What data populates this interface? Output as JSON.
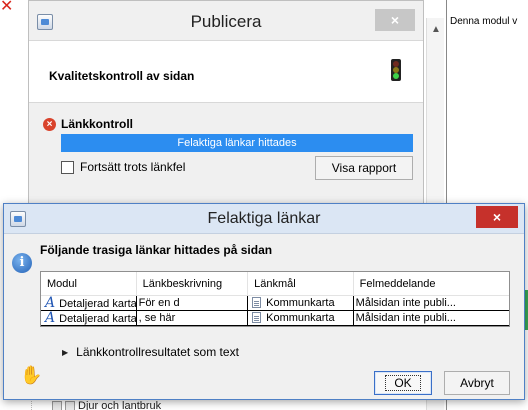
{
  "background": {
    "right_pane_text": "Denna modul v",
    "tree_item_label": "Djur och lantbruk"
  },
  "publish_dialog": {
    "title": "Publicera",
    "close_label": "×",
    "header_title": "Kvalitetskontroll av sidan",
    "section_title": "Länkkontroll",
    "progress_text": "Felaktiga länkar hittades",
    "checkbox_label": "Fortsätt trots länkfel",
    "report_button": "Visa rapport"
  },
  "links_dialog": {
    "title": "Felaktiga länkar",
    "close_label": "×",
    "header": "Följande trasiga länkar hittades på sidan",
    "columns": [
      "Modul",
      "Länkbeskrivning",
      "Länkmål",
      "Felmeddelande"
    ],
    "rows": [
      {
        "modul": "Detaljerad karta",
        "beskrivning": "För en d",
        "mal": "Kommunkarta",
        "fel": "Målsidan inte publi..."
      },
      {
        "modul": "Detaljerad karta",
        "beskrivning": ", se här",
        "mal": "Kommunkarta",
        "fel": "Målsidan inte publi..."
      }
    ],
    "expander_label": "Länkkontrollresultatet som text",
    "ok_button": "OK",
    "cancel_button": "Avbryt"
  },
  "colors": {
    "progress": "#2c8df0",
    "close_red": "#c6312b",
    "error_red": "#d9432c"
  }
}
